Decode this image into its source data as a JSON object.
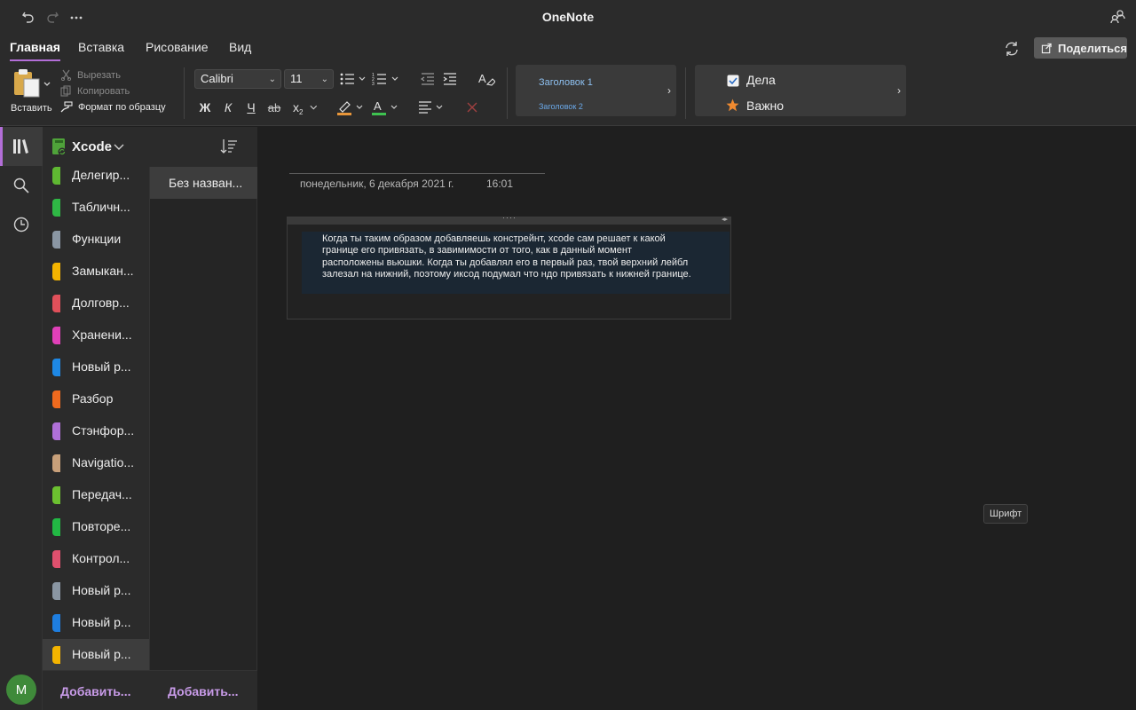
{
  "window": {
    "title": "OneNote"
  },
  "ribbon_tabs": [
    "Главная",
    "Вставка",
    "Рисование",
    "Вид"
  ],
  "share_label": "Поделиться",
  "clipboard": {
    "paste": "Вставить",
    "cut": "Вырезать",
    "copy": "Копировать",
    "format_painter": "Формат по образцу"
  },
  "font": {
    "family": "Calibri",
    "size": "11",
    "bold": "Ж",
    "italic": "К",
    "underline": "Ч",
    "strike": "ab",
    "subscript": "x"
  },
  "styles": {
    "heading1": "Заголовок 1",
    "heading2": "Заголовок 2"
  },
  "tags": {
    "todo": "Дела",
    "important": "Важно"
  },
  "notebook": {
    "name": "Xcode"
  },
  "sections": [
    {
      "label": "Делегир...",
      "color": "#5fb832"
    },
    {
      "label": "Табличн...",
      "color": "#2fb845"
    },
    {
      "label": "Функции",
      "color": "#8a96a3"
    },
    {
      "label": "Замыкан...",
      "color": "#f4b400"
    },
    {
      "label": "Долговр...",
      "color": "#e0505a"
    },
    {
      "label": "Хранени...",
      "color": "#e040b8"
    },
    {
      "label": "Новый р...",
      "color": "#1e88e5"
    },
    {
      "label": "Разбор",
      "color": "#f06a1e"
    },
    {
      "label": "Стэнфор...",
      "color": "#b070d8"
    },
    {
      "label": "Navigatio...",
      "color": "#c8a07a"
    },
    {
      "label": "Передач...",
      "color": "#6cc030"
    },
    {
      "label": "Повторе...",
      "color": "#22b844"
    },
    {
      "label": "Контрол...",
      "color": "#e0506e"
    },
    {
      "label": "Новый р...",
      "color": "#8a96a3"
    },
    {
      "label": "Новый р...",
      "color": "#1e7ee0"
    },
    {
      "label": "Новый р...",
      "color": "#f4b400"
    }
  ],
  "pages": [
    "Без назван..."
  ],
  "add_section": "Добавить...",
  "add_page": "Добавить...",
  "avatar_initial": "M",
  "page": {
    "date": "понедельник, 6 декабря 2021 г.",
    "time": "16:01",
    "note": "Когда ты таким образом добавляешь констрейнт, xcode сам решает к какой границе его привязать, в завимимости от того, как в данный момент расположены вьюшки. Когда ты добавлял его в первый раз, твой верхний лейбл залезал на нижний, поэтому иксод подумал что ндо привязать к нижней границе."
  },
  "tooltip": "Шрифт"
}
